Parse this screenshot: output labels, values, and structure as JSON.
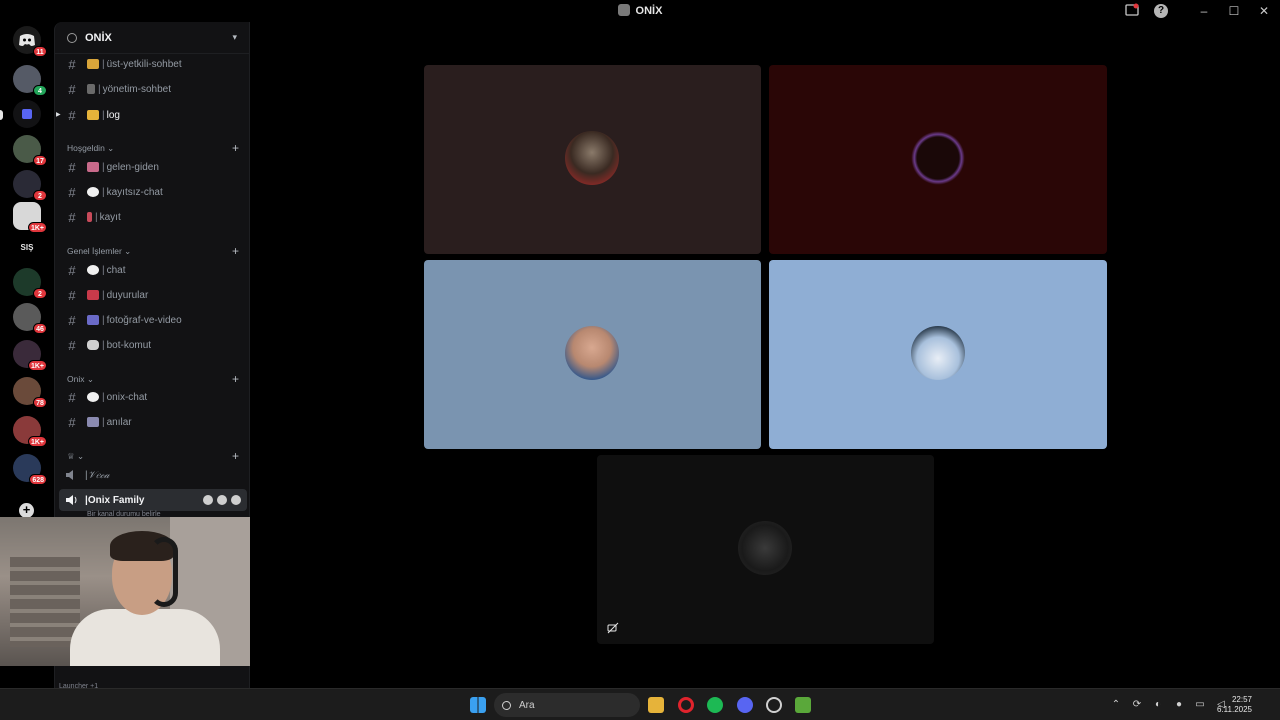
{
  "window": {
    "title": "ONİX"
  },
  "titlebar": {
    "help_icon": "?"
  },
  "rail": {
    "servers": [
      {
        "name": "discord-home",
        "badge": "11"
      },
      {
        "name": "server-1",
        "badge": "4"
      },
      {
        "name": "server-2",
        "badge": ""
      },
      {
        "name": "server-3",
        "badge": "17"
      },
      {
        "name": "server-4",
        "badge": "2"
      },
      {
        "name": "server-5",
        "badge": "1K+"
      },
      {
        "name": "server-sis",
        "label": "SIŞ",
        "badge": ""
      },
      {
        "name": "server-6",
        "badge": "2"
      },
      {
        "name": "server-7",
        "badge": "46"
      },
      {
        "name": "server-8",
        "badge": "1K+"
      },
      {
        "name": "server-9",
        "badge": "78"
      },
      {
        "name": "server-10",
        "badge": "1K+"
      },
      {
        "name": "server-11",
        "badge": "628"
      }
    ],
    "add_server": "+"
  },
  "guild": {
    "name": "ONİX",
    "channels_top": [
      {
        "name": "üst-yetkili-sohbet"
      },
      {
        "name": "yönetim-sohbet"
      },
      {
        "name": "log"
      }
    ],
    "categories": [
      {
        "name": "Hoşgeldin",
        "channels": [
          "gelen-giden",
          "kayıtsız-chat",
          "kayıt"
        ]
      },
      {
        "name": "Genel İşlemler",
        "channels": [
          "chat",
          "duyurular",
          "fotoğraf-ve-video",
          "bot-komut"
        ]
      },
      {
        "name": "Onix",
        "channels": [
          "onix-chat",
          "anılar"
        ]
      }
    ],
    "voice_channels": [
      {
        "name": "𝒱𝑒𝒸𝒶"
      },
      {
        "name": "Onix Family"
      }
    ],
    "voice_status_placeholder": "Bir kanal durumu belirle",
    "launcher_text": "Launcher +1"
  },
  "stage": {
    "tiles": [
      {
        "name": "participant-1",
        "bg": "#2a1e1e"
      },
      {
        "name": "participant-2",
        "bg": "#2a0606"
      },
      {
        "name": "participant-3",
        "bg": "#7a94b0"
      },
      {
        "name": "participant-4",
        "bg": "#8faed4"
      },
      {
        "name": "participant-5",
        "bg": "#0f0f0f"
      }
    ]
  },
  "taskbar": {
    "search_placeholder": "Ara",
    "time": "22:57",
    "date": "6.11.2025"
  }
}
